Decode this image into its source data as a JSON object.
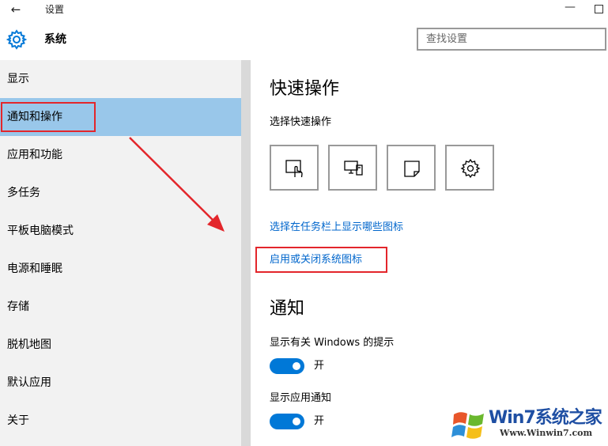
{
  "window": {
    "title": "设置",
    "back_icon": "back-arrow-icon"
  },
  "header": {
    "section_title": "系统",
    "search_placeholder": "查找设置"
  },
  "sidebar": {
    "items": [
      {
        "label": "显示"
      },
      {
        "label": "通知和操作",
        "active": true
      },
      {
        "label": "应用和功能"
      },
      {
        "label": "多任务"
      },
      {
        "label": "平板电脑模式"
      },
      {
        "label": "电源和睡眠"
      },
      {
        "label": "存储"
      },
      {
        "label": "脱机地图"
      },
      {
        "label": "默认应用"
      },
      {
        "label": "关于"
      }
    ]
  },
  "main": {
    "quick_actions_title": "快速操作",
    "quick_actions_subtitle": "选择快速操作",
    "tiles": [
      {
        "icon": "tablet-mode-icon"
      },
      {
        "icon": "connect-icon"
      },
      {
        "icon": "note-icon"
      },
      {
        "icon": "all-settings-icon"
      }
    ],
    "link_taskbar_icons": "选择在任务栏上显示哪些图标",
    "link_system_icons": "启用或关闭系统图标",
    "notifications_title": "通知",
    "setting_windows_tips": {
      "label": "显示有关 Windows 的提示",
      "state": "开"
    },
    "setting_app_notifications": {
      "label": "显示应用通知",
      "state": "开"
    }
  },
  "watermark": {
    "logo_text": "Win7系统之家",
    "url": "Www.Winwin7.com"
  },
  "colors": {
    "accent": "#0078d7",
    "active_item": "#99c7ea",
    "highlight": "#e3262b",
    "link": "#0066cc"
  }
}
